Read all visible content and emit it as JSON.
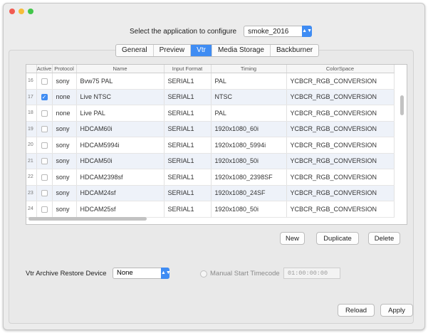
{
  "header": {
    "select_label": "Select the application to configure",
    "app_value": "smoke_2016"
  },
  "tabs": [
    {
      "label": "General"
    },
    {
      "label": "Preview"
    },
    {
      "label": "Vtr",
      "active": true
    },
    {
      "label": "Media Storage"
    },
    {
      "label": "Backburner"
    }
  ],
  "table": {
    "columns": [
      "",
      "Active",
      "Protocol",
      "Name",
      "Input Format",
      "Timing",
      "ColorSpace"
    ],
    "rows": [
      {
        "num": "16",
        "active": false,
        "protocol": "sony",
        "name": "Bvw75 PAL",
        "input": "SERIAL1",
        "timing": "PAL",
        "color": "YCBCR_RGB_CONVERSION"
      },
      {
        "num": "17",
        "active": true,
        "protocol": "none",
        "name": "Live NTSC",
        "input": "SERIAL1",
        "timing": "NTSC",
        "color": "YCBCR_RGB_CONVERSION"
      },
      {
        "num": "18",
        "active": false,
        "protocol": "none",
        "name": "Live PAL",
        "input": "SERIAL1",
        "timing": "PAL",
        "color": "YCBCR_RGB_CONVERSION"
      },
      {
        "num": "19",
        "active": false,
        "protocol": "sony",
        "name": "HDCAM60i",
        "input": "SERIAL1",
        "timing": "1920x1080_60i",
        "color": "YCBCR_RGB_CONVERSION"
      },
      {
        "num": "20",
        "active": false,
        "protocol": "sony",
        "name": "HDCAM5994i",
        "input": "SERIAL1",
        "timing": "1920x1080_5994i",
        "color": "YCBCR_RGB_CONVERSION"
      },
      {
        "num": "21",
        "active": false,
        "protocol": "sony",
        "name": "HDCAM50i",
        "input": "SERIAL1",
        "timing": "1920x1080_50i",
        "color": "YCBCR_RGB_CONVERSION"
      },
      {
        "num": "22",
        "active": false,
        "protocol": "sony",
        "name": "HDCAM2398sf",
        "input": "SERIAL1",
        "timing": "1920x1080_2398SF",
        "color": "YCBCR_RGB_CONVERSION"
      },
      {
        "num": "23",
        "active": false,
        "protocol": "sony",
        "name": "HDCAM24sf",
        "input": "SERIAL1",
        "timing": "1920x1080_24SF",
        "color": "YCBCR_RGB_CONVERSION"
      },
      {
        "num": "24",
        "active": false,
        "protocol": "sony",
        "name": "HDCAM25sf",
        "input": "SERIAL1",
        "timing": "1920x1080_50i",
        "color": "YCBCR_RGB_CONVERSION"
      }
    ]
  },
  "buttons": {
    "new": "New",
    "duplicate": "Duplicate",
    "delete": "Delete",
    "reload": "Reload",
    "apply": "Apply"
  },
  "vtr_archive": {
    "label": "Vtr Archive Restore Device",
    "value": "None"
  },
  "manual_start": {
    "label": "Manual Start Timecode",
    "value": "01:00:00:00"
  },
  "colors": {
    "accent": "#3f8cf3",
    "close": "#f15b52",
    "minimize": "#f6bd3a",
    "zoom": "#42c64a"
  }
}
